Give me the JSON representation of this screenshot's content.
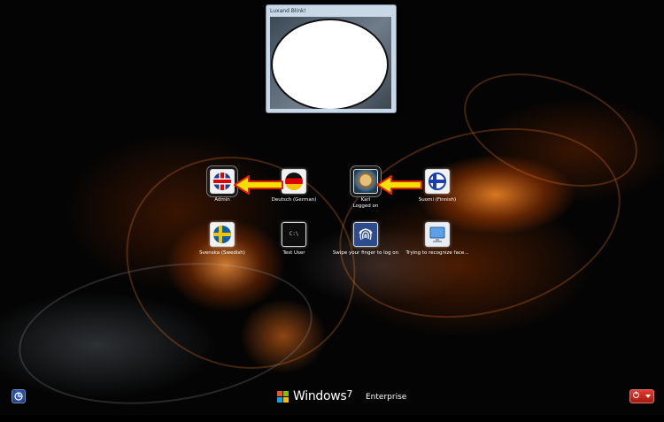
{
  "camera_window": {
    "title": "Luxand Blink!"
  },
  "tiles": [
    {
      "label": "Admin",
      "sublabel": "",
      "icon": "uk-flag-icon"
    },
    {
      "label": "Deutsch (German)",
      "sublabel": "",
      "icon": "german-flag-icon"
    },
    {
      "label": "Kari",
      "sublabel": "Logged on",
      "icon": "user-avatar-icon"
    },
    {
      "label": "Suomi (Finnish)",
      "sublabel": "",
      "icon": "finnish-flag-icon"
    },
    {
      "label": "Svenska (Swedish)",
      "sublabel": "",
      "icon": "swedish-flag-icon"
    },
    {
      "label": "Test User",
      "sublabel": "",
      "icon": "command-prompt-icon",
      "icon_text": "C:\\"
    },
    {
      "label": "Swipe your finger to log on",
      "sublabel": "",
      "icon": "fingerprint-icon"
    },
    {
      "label": "Trying to recognize face...",
      "sublabel": "",
      "icon": "computer-monitor-icon"
    }
  ],
  "footer": {
    "brand_name": "Windows",
    "brand_version": "7",
    "brand_edition": "Enterprise"
  },
  "colors": {
    "arrow_fill": "#f4e000",
    "arrow_outline": "#e02000",
    "background": "#040404",
    "accent_orange": "#ff8a28"
  }
}
